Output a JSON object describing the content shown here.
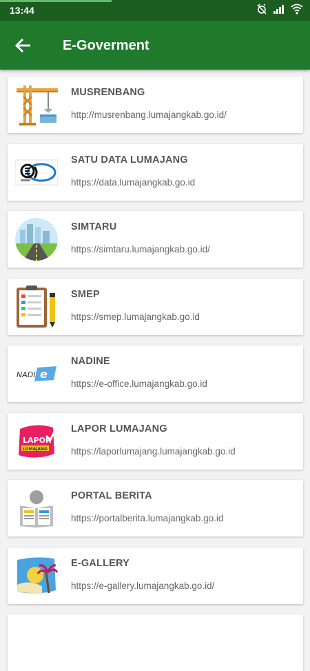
{
  "status": {
    "time": "13:44",
    "progress": 0.36
  },
  "appbar": {
    "title": "E-Goverment"
  },
  "items": [
    {
      "name": "MUSRENBANG",
      "url": "http://musrenbang.lumajangkab.go.id/",
      "icon": "crane-icon"
    },
    {
      "name": "SATU DATA LUMAJANG",
      "url": "https://data.lumajangkab.go.id",
      "icon": "satu-data-logo-icon"
    },
    {
      "name": "SIMTARU",
      "url": "https://simtaru.lumajangkab.go.id/",
      "icon": "city-road-icon"
    },
    {
      "name": "SMEP",
      "url": "https://smep.lumajangkab.go.id",
      "icon": "clipboard-icon"
    },
    {
      "name": "NADINE",
      "url": "https://e-office.lumajangkab.go.id",
      "icon": "nadine-logo-icon"
    },
    {
      "name": "LAPOR LUMAJANG",
      "url": "https://laporlumajang.lumajangkab.go.id",
      "icon": "lapor-logo-icon",
      "logo_text": "LAPOR LUMAJANG"
    },
    {
      "name": "PORTAL BERITA",
      "url": "https://portalberita.lumajangkab.go.id",
      "icon": "newspaper-reader-icon"
    },
    {
      "name": "E-GALLERY",
      "url": "https://e-gallery.lumajangkab.go.id/",
      "icon": "beach-gallery-icon"
    },
    {
      "name": "",
      "url": "",
      "icon": ""
    }
  ],
  "colors": {
    "statusbar": "#1b5e20",
    "appbar": "#1f7a2c",
    "background": "#f2f2f2",
    "card": "#ffffff"
  }
}
